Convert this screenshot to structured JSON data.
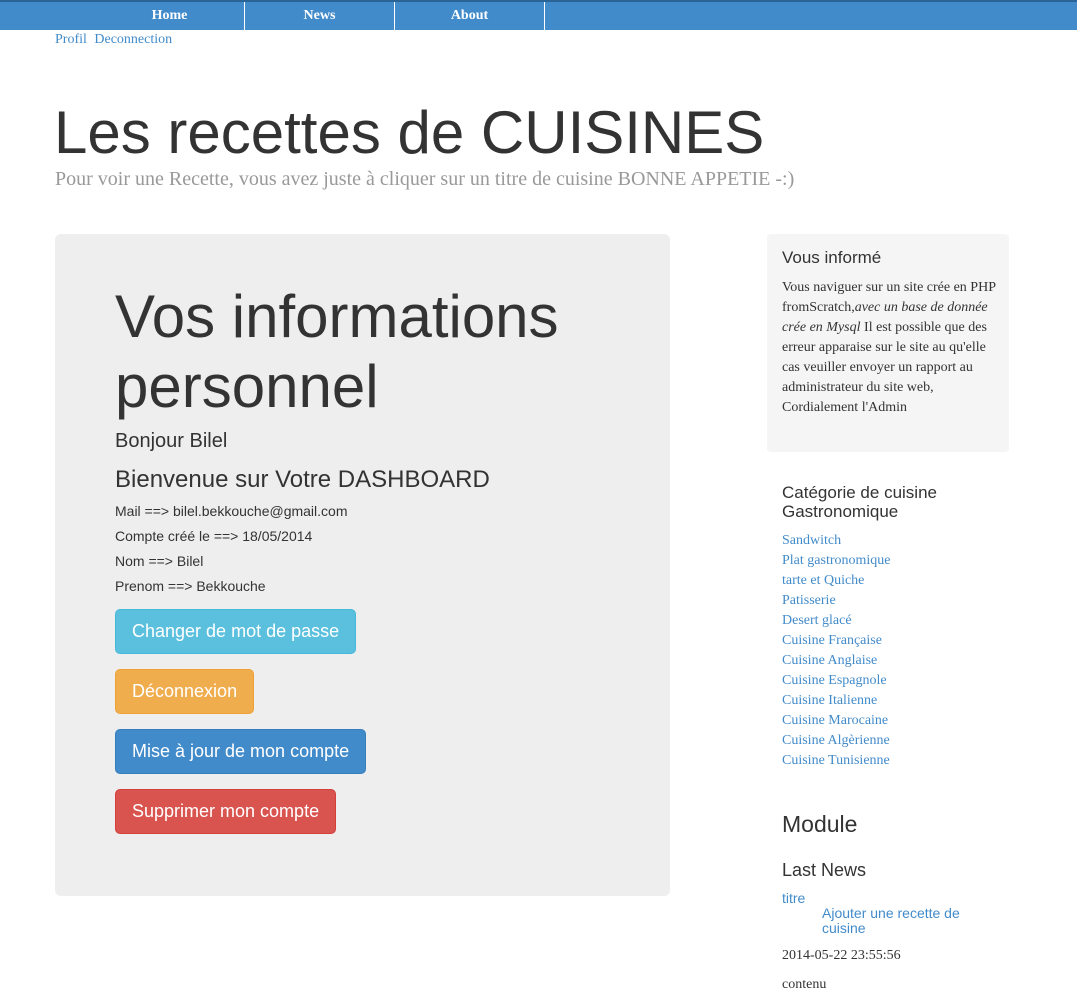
{
  "nav": {
    "home": "Home",
    "news": "News",
    "about": "About"
  },
  "userlinks": {
    "profil": "Profil",
    "deconnection": "Deconnection"
  },
  "header": {
    "title": "Les recettes de CUISINES",
    "subtitle": "Pour voir une Recette, vous avez juste à cliquer sur un titre de cuisine BONNE APPETIE -:)"
  },
  "dashboard": {
    "heading": "Vos informations personnel",
    "greeting": "Bonjour Bilel",
    "welcome": "Bienvenue sur Votre DASHBOARD",
    "mail": "Mail ==> bilel.bekkouche@gmail.com",
    "created": "Compte créé le ==> 18/05/2014",
    "nom": "Nom ==> Bilel",
    "prenom": "Prenom ==> Bekkouche",
    "buttons": {
      "change_password": "Changer de mot de passe",
      "logout": "Déconnexion",
      "update_account": "Mise à jour de mon compte",
      "delete_account": "Supprimer mon compte"
    }
  },
  "info_box": {
    "title": "Vous informé",
    "text_1": "Vous naviguer sur un site crée en PHP fromScratch,",
    "text_italic": "avec un base de donnée crée en Mysql",
    "text_2": " Il est possible que des erreur apparaise sur le site au qu'elle cas veuiller envoyer un rapport au administrateur du site web, Cordialement l'Admin"
  },
  "categories": {
    "title": "Catégorie de cuisine Gastronomique",
    "items": [
      "Sandwitch",
      "Plat gastronomique",
      "tarte et Quiche",
      "Patisserie",
      "Desert glacé",
      "Cuisine Française",
      "Cuisine Anglaise",
      "Cuisine Espagnole",
      "Cuisine Italienne",
      "Cuisine Marocaine",
      "Cuisine Algèrienne",
      "Cuisine Tunisienne"
    ]
  },
  "module": {
    "title": "Module",
    "last_news_title": "Last News",
    "news_titre": "titre",
    "news_link": "Ajouter une recette de cuisine",
    "news_date": "2014-05-22 23:55:56",
    "news_contenu": "contenu"
  },
  "colors": {
    "primary": "#428bca",
    "info": "#5bc0de",
    "warning": "#f0ad4e",
    "danger": "#d9534f",
    "panel": "#eeeeee"
  }
}
